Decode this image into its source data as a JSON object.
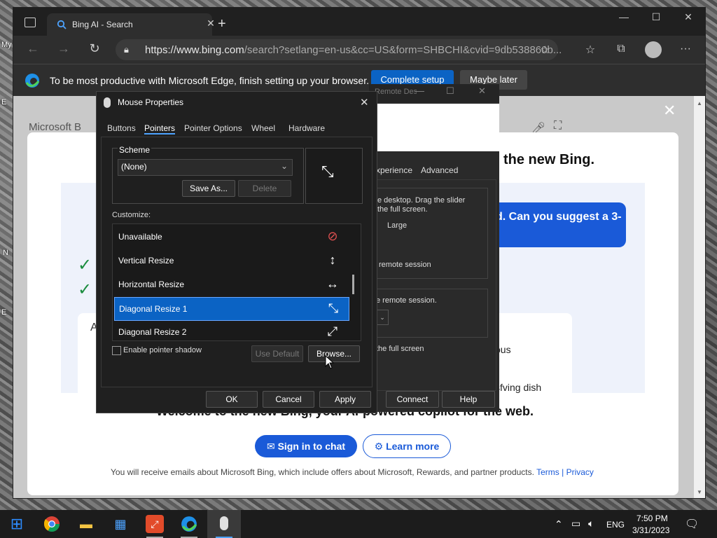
{
  "desktop": {
    "left_labels": [
      "My",
      "E",
      "N",
      "E"
    ]
  },
  "browser": {
    "tab_title": "Bing AI - Search",
    "url_host": "https://www.bing.com",
    "url_path": "/search?setlang=en-us&cc=US&form=SHBCHI&cvid=9db538860b...",
    "infobar_message": "To be most productive with Microsoft Edge, finish setting up your browser.",
    "complete_setup": "Complete setup",
    "maybe_later": "Maybe later"
  },
  "page": {
    "brand": "Microsoft B",
    "headline_partial": "the new Bing.",
    "bubble_text": "d. Can you suggest a 3-",
    "partial_right_1": "ous",
    "partial_right_2": "sfving dish",
    "partial_left": "A",
    "welcome": "Welcome to the new Bing, your AI-powered copilot for the web.",
    "sign_in": "Sign in to chat",
    "learn_more": "Learn more",
    "disclaimer": "You will receive emails about Microsoft Bing, which include offers about Microsoft, Rewards, and partner products.",
    "terms": "Terms",
    "separator": "|",
    "privacy": "Privacy"
  },
  "rdc": {
    "title": "Remote Desktop Connection",
    "tab_experience": "xperience",
    "tab_advanced": "Advanced",
    "line1": "e desktop. Drag the slider",
    "line2": "the full screen.",
    "large": "Large",
    "line3": "remote session",
    "line4": "e remote session.",
    "line5": "the full screen",
    "connect": "Connect",
    "help": "Help"
  },
  "dialog": {
    "title": "Mouse Properties",
    "tabs": [
      "Buttons",
      "Pointers",
      "Pointer Options",
      "Wheel",
      "Hardware"
    ],
    "active_tab": "Pointers",
    "scheme_label": "Scheme",
    "scheme_value": "(None)",
    "save_as": "Save As...",
    "delete": "Delete",
    "customize_label": "Customize:",
    "rows": [
      {
        "label": "Unavailable",
        "icon": "⊘"
      },
      {
        "label": "Vertical Resize",
        "icon": "↕"
      },
      {
        "label": "Horizontal Resize",
        "icon": "↔"
      },
      {
        "label": "Diagonal Resize 1",
        "icon": "⤡"
      },
      {
        "label": "Diagonal Resize 2",
        "icon": "⤢"
      }
    ],
    "selected_row": "Diagonal Resize 1",
    "enable_shadow": "Enable pointer shadow",
    "use_default": "Use Default",
    "browse": "Browse...",
    "ok": "OK",
    "cancel": "Cancel",
    "apply": "Apply"
  },
  "taskbar": {
    "language": "ENG",
    "time": "7:50 PM",
    "date": "3/31/2023"
  },
  "colors": {
    "accent": "#0b63c4",
    "bing_blue": "#1a5ad8"
  }
}
